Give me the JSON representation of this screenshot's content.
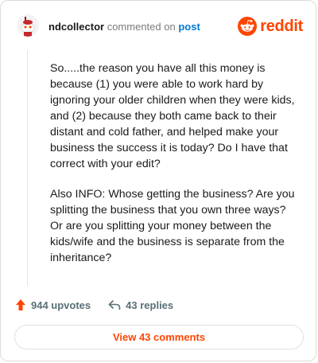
{
  "header": {
    "username": "ndcollector",
    "action_text": "commented on",
    "post_link": "post",
    "brand": "reddit"
  },
  "comment": {
    "paragraphs": [
      "So.....the reason you have all this money is because (1) you were able to work hard by ignoring your older children when they were kids, and (2) because they both came back to their distant and cold father, and helped make your business the success it is today? Do I have that correct with your edit?",
      "Also INFO: Whose getting the business? Are you splitting the business that you own three ways? Or are you splitting your money between the kids/wife and the business is separate from the inheritance?"
    ]
  },
  "footer": {
    "upvotes": "944 upvotes",
    "replies": "43 replies",
    "view_button": "View 43 comments"
  },
  "icons": {
    "avatar": "snoo-avatar-icon",
    "brand_logo": "reddit-logo-icon",
    "upvote": "upvote-arrow-icon",
    "reply": "reply-arrow-icon"
  },
  "colors": {
    "brand": "#ff4500",
    "link": "#0079d3",
    "muted": "#576f76"
  }
}
